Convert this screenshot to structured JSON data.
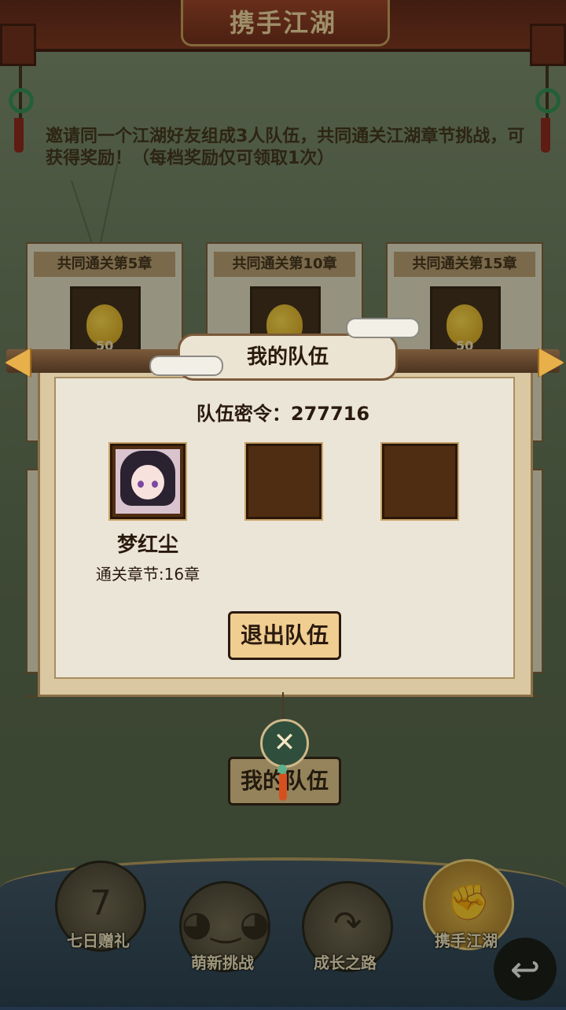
{
  "header": {
    "title": "携手江湖"
  },
  "intro": "邀请同一个江湖好友组成3人队伍，共同通关江湖章节挑战，可获得奖励！（每档奖励仅可领取1次）",
  "reward_cards": [
    {
      "title": "共同通关第5章",
      "qty": "50"
    },
    {
      "title": "共同通关第10章",
      "qty": "50"
    },
    {
      "title": "共同通关第15章",
      "qty": "50"
    }
  ],
  "bottom_button": "我的队伍",
  "modal": {
    "title": "我的队伍",
    "team_code": "队伍密令：277716",
    "member": {
      "name": "梦红尘",
      "progress": "通关章节:16章"
    },
    "leave_label": "退出队伍",
    "close_glyph": "✕"
  },
  "nav": {
    "items": [
      {
        "label": "七日赠礼",
        "badge": "7"
      },
      {
        "label": "萌新挑战"
      },
      {
        "label": "成长之路"
      },
      {
        "label": "携手江湖",
        "active": true
      }
    ],
    "back_glyph": "↩"
  },
  "colors": {
    "accent": "#e8b84a",
    "header": "#7a2c18",
    "jade": "#2e8a52"
  },
  "icons": [
    "gourd-icon",
    "close-icon",
    "back-arrow-icon",
    "jade-pendant-icon"
  ]
}
